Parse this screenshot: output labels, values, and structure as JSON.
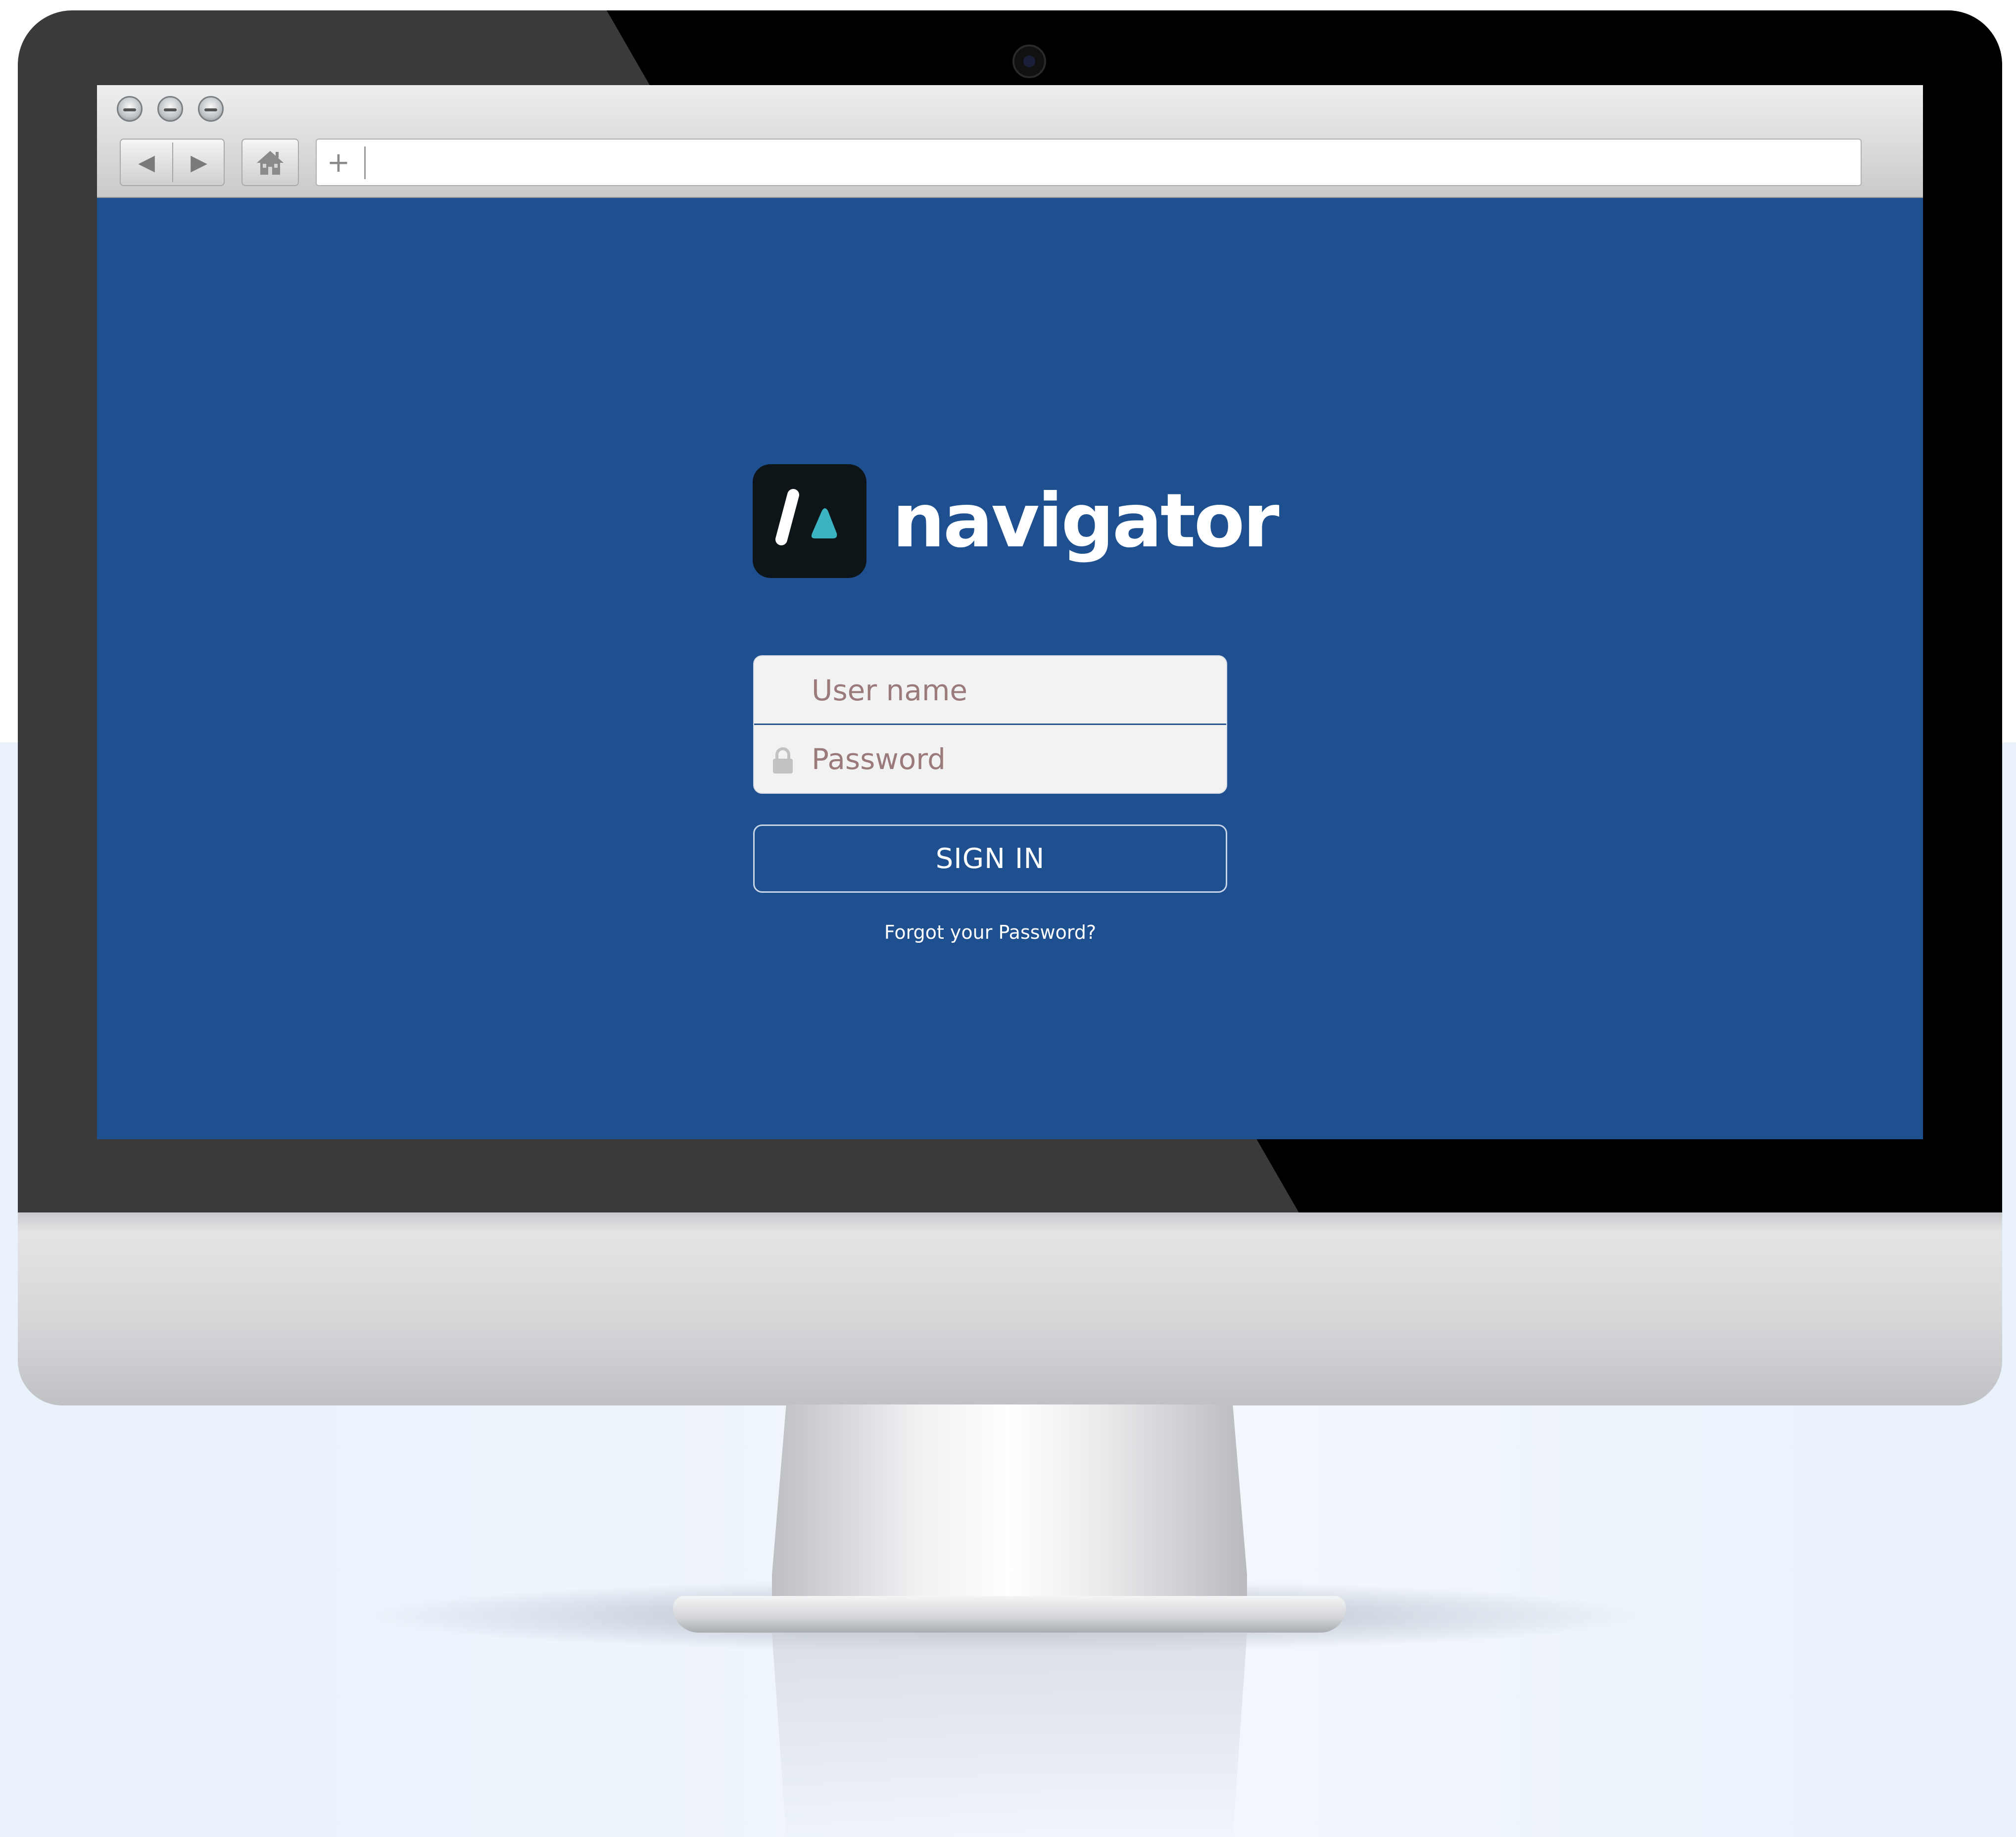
{
  "brand": {
    "name": "navigator"
  },
  "browser": {
    "back_icon": "triangle-left",
    "forward_icon": "triangle-right",
    "home_icon": "house",
    "new_tab_label": "+",
    "url": ""
  },
  "login": {
    "username_placeholder": "User name",
    "password_placeholder": "Password",
    "signin_label": "SIGN IN",
    "forgot_label": "Forgot your Password?"
  },
  "colors": {
    "page_background": "#1e4f8f",
    "logo_background": "#0e1518",
    "logo_accent": "#3bb3c3",
    "placeholder_text": "#9a7a7a"
  }
}
